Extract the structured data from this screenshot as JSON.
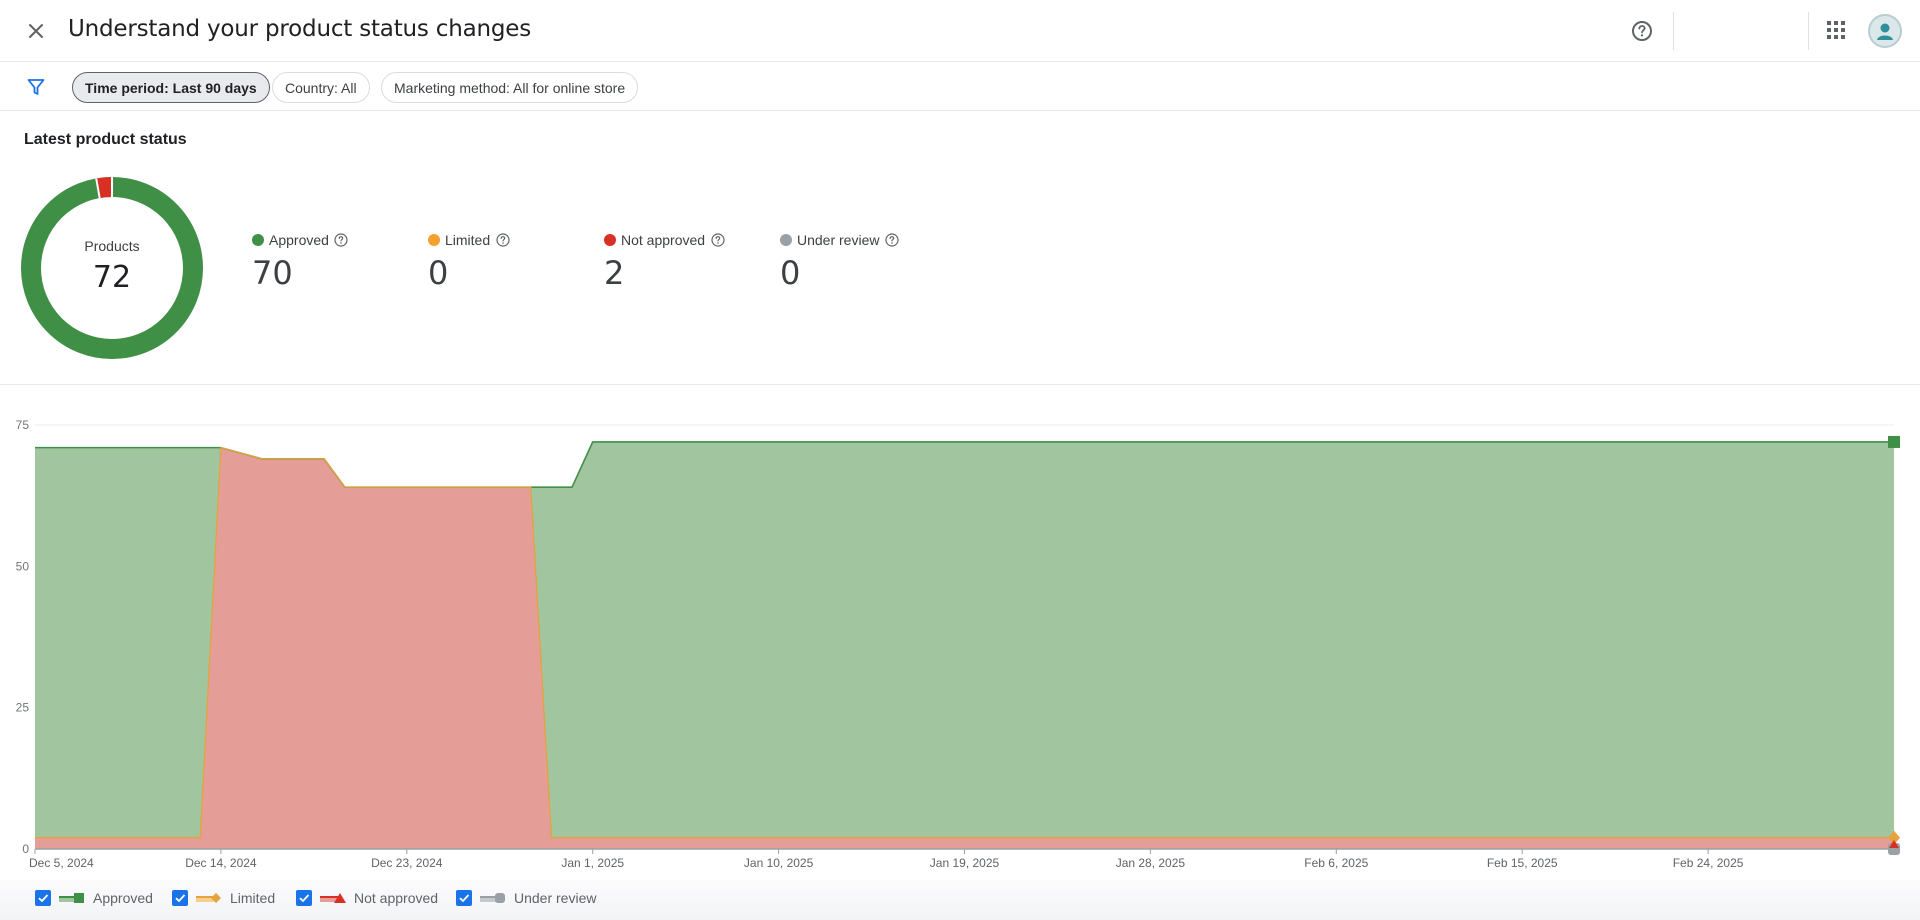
{
  "header": {
    "title": "Understand your product status changes"
  },
  "filters": [
    {
      "label": "Time period: Last 90 days",
      "active": true
    },
    {
      "label": "Country: All",
      "active": false
    },
    {
      "label": "Marketing method: All for online store",
      "active": false
    }
  ],
  "latest": {
    "title": "Latest product status",
    "donut_label": "Products",
    "total": "72",
    "stats": [
      {
        "label": "Approved",
        "value": "70",
        "color": "#3f8f46"
      },
      {
        "label": "Limited",
        "value": "0",
        "color": "#f3a030"
      },
      {
        "label": "Not approved",
        "value": "2",
        "color": "#d93025"
      },
      {
        "label": "Under review",
        "value": "0",
        "color": "#9aa0a6"
      }
    ]
  },
  "colors": {
    "approved_fill": "#a1c59f",
    "approved_line": "#3f8f46",
    "not_approved_fill": "#e59e97",
    "limited_line": "#e6a23c",
    "under_review": "#9aa0a6",
    "accent": "#1a73e8"
  },
  "chart_data": {
    "type": "area",
    "stacked": true,
    "x": [
      "2024-12-05",
      "2024-12-13",
      "2024-12-14",
      "2024-12-16",
      "2024-12-19",
      "2024-12-20",
      "2024-12-29",
      "2024-12-30",
      "2024-12-31",
      "2025-01-01",
      "2025-03-05"
    ],
    "series": [
      {
        "name": "Not approved",
        "values": [
          2,
          2,
          71,
          69,
          69,
          64,
          64,
          2,
          2,
          2,
          2
        ]
      },
      {
        "name": "Approved",
        "values": [
          69,
          69,
          0,
          0,
          0,
          0,
          0,
          62,
          62,
          70,
          70
        ]
      },
      {
        "name": "Limited",
        "values": [
          0,
          0,
          0,
          0,
          0,
          0,
          0,
          0,
          0,
          0,
          0
        ]
      },
      {
        "name": "Under review",
        "values": [
          0,
          0,
          0,
          0,
          0,
          0,
          0,
          0,
          0,
          0,
          0
        ]
      }
    ],
    "ylim": [
      0,
      75
    ],
    "yticks": [
      "0",
      "25",
      "50",
      "75"
    ],
    "xticks": [
      "Dec 5, 2024",
      "Dec 14, 2024",
      "Dec 23, 2024",
      "Jan 1, 2025",
      "Jan 10, 2025",
      "Jan 19, 2025",
      "Jan 28, 2025",
      "Feb 6, 2025",
      "Feb 15, 2025",
      "Feb 24, 2025"
    ],
    "grid": true,
    "legend": "bottom-left"
  },
  "legend": [
    {
      "label": "Approved"
    },
    {
      "label": "Limited"
    },
    {
      "label": "Not approved"
    },
    {
      "label": "Under review"
    }
  ]
}
